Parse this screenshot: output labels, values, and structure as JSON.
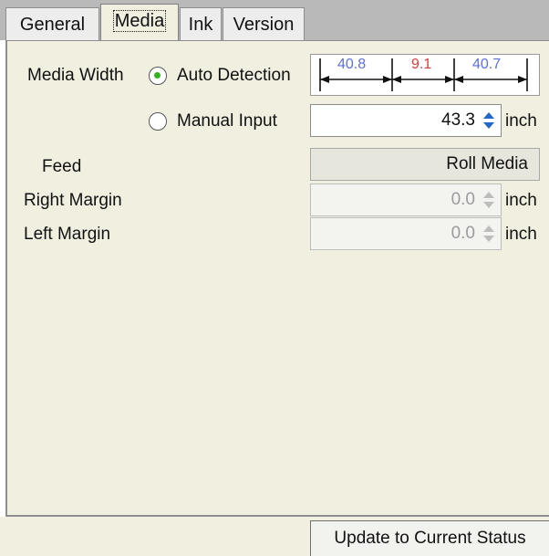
{
  "tabs": [
    {
      "label": "General",
      "active": false
    },
    {
      "label": "Media",
      "active": true
    },
    {
      "label": "Ink",
      "active": false
    },
    {
      "label": "Version",
      "active": false
    }
  ],
  "media_width": {
    "label": "Media Width",
    "auto_detection": {
      "label": "Auto Detection",
      "selected": true
    },
    "manual_input": {
      "label": "Manual Input",
      "selected": false,
      "value": "43.3",
      "unit": "inch"
    },
    "diagram": {
      "left": "40.8",
      "center": "9.1",
      "right": "40.7",
      "left_color": "#5b6fe6",
      "center_color": "#e23a3a",
      "right_color": "#5b6fe6"
    }
  },
  "feed": {
    "label": "Feed",
    "value": "Roll Media"
  },
  "right_margin": {
    "label": "Right Margin",
    "value": "0.0",
    "unit": "inch"
  },
  "left_margin": {
    "label": "Left Margin",
    "value": "0.0",
    "unit": "inch"
  },
  "buttons": {
    "update": "Update to Current Status"
  },
  "colors": {
    "accent_radio": "#32b51c",
    "spin_arrows": "#2166c9",
    "panel_bg": "#f0efe0"
  },
  "icons": {
    "spinner": "up-down-arrows-icon",
    "radio": "radio-button"
  }
}
